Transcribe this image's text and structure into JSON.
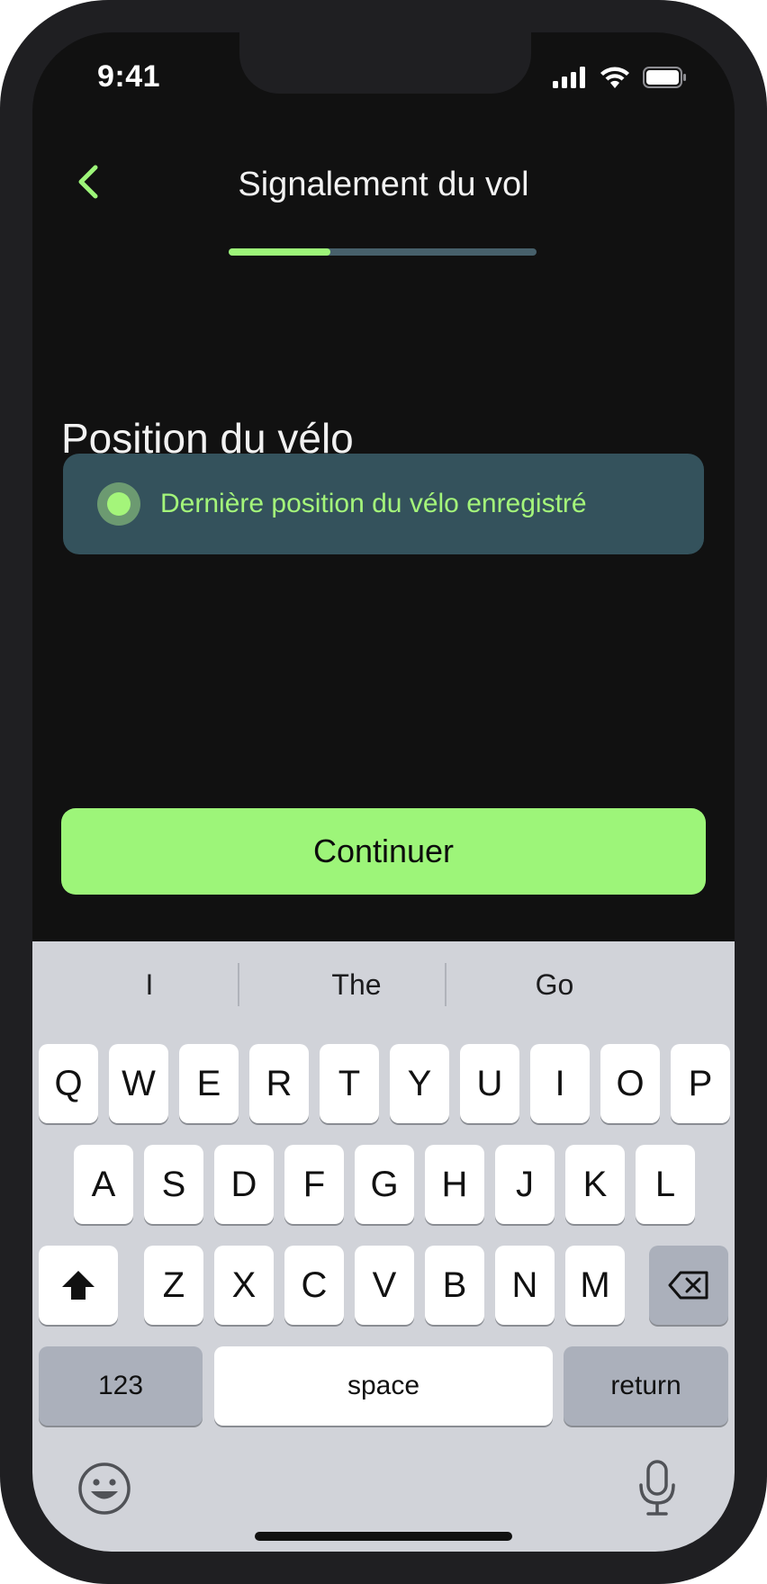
{
  "status_bar": {
    "time": "9:41"
  },
  "header": {
    "title": "Signalement du vol",
    "progress": 0.33
  },
  "section": {
    "title": "Position du vélo"
  },
  "option": {
    "label": "Dernière position du vélo enregistré",
    "selected": true
  },
  "continue_button": {
    "label": "Continuer"
  },
  "keyboard": {
    "suggestions": [
      "I",
      "The",
      "Go"
    ],
    "row1": [
      "Q",
      "W",
      "E",
      "R",
      "T",
      "Y",
      "U",
      "I",
      "O",
      "P"
    ],
    "row2": [
      "A",
      "S",
      "D",
      "F",
      "G",
      "H",
      "J",
      "K",
      "L"
    ],
    "row3": [
      "Z",
      "X",
      "C",
      "V",
      "B",
      "N",
      "M"
    ],
    "numbers_label": "123",
    "space_label": "space",
    "return_label": "return"
  },
  "colors": {
    "accent": "#9df579",
    "panel": "#34525c",
    "background": "#111111"
  },
  "icons": [
    "signal-icon",
    "wifi-icon",
    "battery-icon",
    "back-chevron-icon",
    "shift-icon",
    "delete-icon",
    "emoji-icon",
    "microphone-icon"
  ]
}
